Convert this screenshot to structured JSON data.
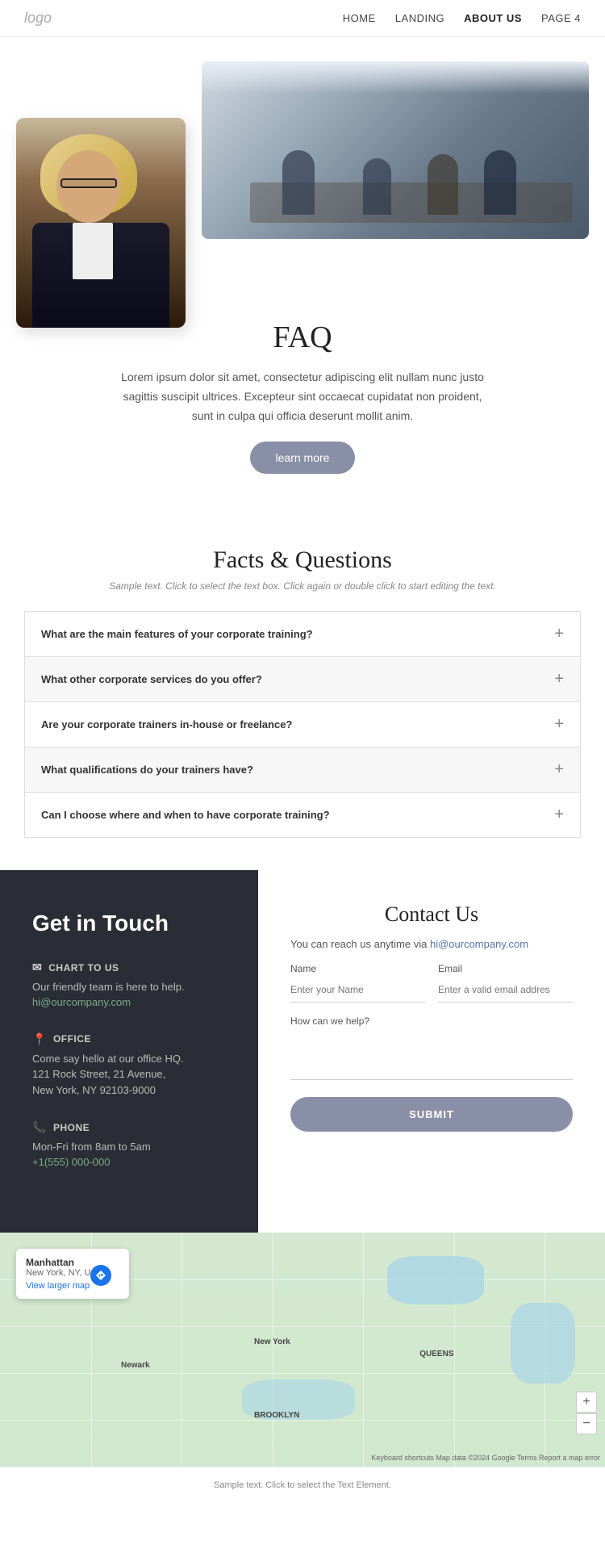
{
  "header": {
    "logo": "logo",
    "nav": [
      {
        "label": "HOME",
        "active": false
      },
      {
        "label": "LANDING",
        "active": false
      },
      {
        "label": "ABOUT US",
        "active": true
      },
      {
        "label": "PAGE 4",
        "active": false
      }
    ]
  },
  "hero": {
    "faq_title": "FAQ",
    "faq_desc": "Lorem ipsum dolor sit amet, consectetur adipiscing elit nullam nunc justo sagittis suscipit ultrices. Excepteur sint occaecat cupidatat non proident, sunt in culpa qui officia deserunt mollit anim.",
    "learn_more_label": "learn more"
  },
  "facts": {
    "title": "Facts & Questions",
    "subtitle": "Sample text. Click to select the text box. Click again or double click to start editing the text.",
    "items": [
      {
        "question": "What are the main features of your corporate training?"
      },
      {
        "question": "What other corporate services do you offer?"
      },
      {
        "question": "Are your corporate trainers in-house or freelance?"
      },
      {
        "question": "What qualifications do your trainers have?"
      },
      {
        "question": "Can I choose where and when to have corporate training?"
      }
    ]
  },
  "get_in_touch": {
    "title": "Get in Touch",
    "chart_label": "CHART TO US",
    "chart_desc": "Our friendly team is here to help.",
    "chart_email": "hi@ourcompany.com",
    "office_label": "OFFICE",
    "office_desc1": "Come say hello at our office HQ.",
    "office_desc2": "121 Rock Street, 21 Avenue,",
    "office_desc3": "New York, NY 92103-9000",
    "phone_label": "PHONE",
    "phone_hours": "Mon-Fri from 8am to 5am",
    "phone_number": "+1(555) 000-000"
  },
  "contact_form": {
    "title": "Contact Us",
    "desc_prefix": "You can reach us anytime via ",
    "contact_email": "hi@ourcompany.com",
    "name_label": "Name",
    "name_placeholder": "Enter your Name",
    "email_label": "Email",
    "email_placeholder": "Enter a valid email addres",
    "message_label": "How can we help?",
    "submit_label": "SUBMIT"
  },
  "map": {
    "location_title": "Manhattan",
    "location_sub": "New York, NY, USA",
    "directions_label": "Directions",
    "view_larger": "View larger map",
    "credits": "Keyboard shortcuts  Map data ©2024 Google  Terms  Report a map error"
  },
  "footer": {
    "text": "Sample text. Click to select the Text Element."
  }
}
